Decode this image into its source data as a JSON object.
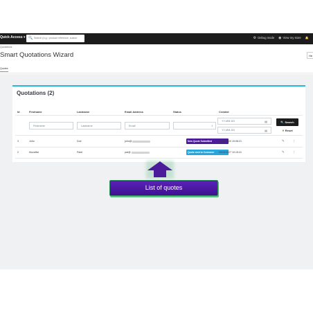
{
  "topbar": {
    "quick_access": "Quick Access ▾",
    "search_placeholder": "Search (e.g.: product reference, custon",
    "debug_mode": "Debug mode",
    "view_store": "View my store"
  },
  "header": {
    "breadcrumb": "Quotations",
    "title": "Smart Quotations Wizard",
    "help": "He",
    "tab": "Quotes"
  },
  "card": {
    "title": "Quotations",
    "count": "(2)"
  },
  "table": {
    "columns": [
      "Id",
      "Firstname",
      "Lastname",
      "Email Address",
      "Status",
      "Created"
    ],
    "filters": {
      "firstname_placeholder": "Firstname",
      "lastname_placeholder": "Lastname",
      "email_placeholder": "Email",
      "date_from_placeholder": "YY-MM-DD",
      "date_to_placeholder": "YY-MM-DD"
    },
    "search_label": "Search",
    "reset_label": "Reset",
    "rows": [
      {
        "id": "3",
        "firstname": "John",
        "lastname": "Doe",
        "email": "john@",
        "status": "New Quote Submitted",
        "status_color": "#4b1b9b",
        "created": "2023/10/20 15:08:21"
      },
      {
        "id": "2",
        "firstname": "Muzaffar",
        "lastname": "Patel",
        "email": "pat@",
        "status": "Quote sent to Customer",
        "status_color": "#25a7dd",
        "created": "2023/10/27 10:15:41"
      }
    ]
  },
  "callout": {
    "text": "List of quotes"
  },
  "colors": {
    "accent": "#25b9d7",
    "callout_purple": "#4b1b9b"
  }
}
